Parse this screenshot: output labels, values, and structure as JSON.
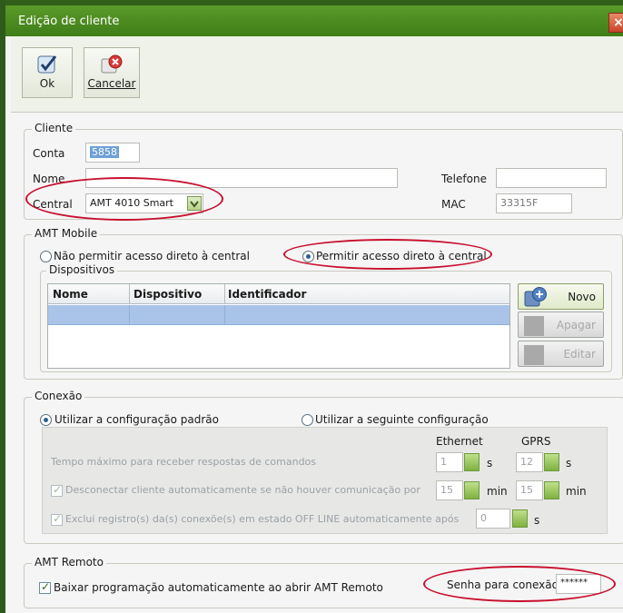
{
  "window": {
    "title": "Edição de cliente",
    "close": "×"
  },
  "toolbar": {
    "ok_label": "Ok",
    "cancel_label": "Cancelar"
  },
  "cliente": {
    "legend": "Cliente",
    "conta_label": "Conta",
    "conta_value": "5858",
    "nome_label": "Nome",
    "nome_value": "",
    "central_label": "Central",
    "central_value": "AMT 4010 Smart",
    "telefone_label": "Telefone",
    "telefone_value": "",
    "mac_label": "MAC",
    "mac_value": "33315F"
  },
  "amt_mobile": {
    "legend": "AMT Mobile",
    "option_no_access": "Não permitir acesso direto à central",
    "option_allow_access": "Permitir acesso direto à central",
    "dispositivos_legend": "Dispositivos",
    "columns": [
      "Nome",
      "Dispositivo",
      "Identificador"
    ],
    "buttons": {
      "novo": "Novo",
      "apagar": "Apagar",
      "editar": "Editar"
    }
  },
  "conexao": {
    "legend": "Conexão",
    "option_default": "Utilizar a configuração padrão",
    "option_custom": "Utilizar a seguinte configuração",
    "ethernet_label": "Ethernet",
    "gprs_label": "GPRS",
    "timeout_label": "Tempo máximo para receber respostas de comandos",
    "timeout_ethernet": "1",
    "timeout_gprs": "12",
    "unit_s": "s",
    "disconnect_label": "Desconectar cliente automaticamente se não houver comunicação por",
    "disconnect_ethernet": "15",
    "disconnect_gprs": "15",
    "unit_min": "min",
    "offline_label": "Exclui registro(s) da(s) conexõe(s) em estado OFF LINE automaticamente após",
    "offline_value": "0"
  },
  "amt_remoto": {
    "legend": "AMT Remoto",
    "auto_download_label": "Baixar programação automaticamente ao abrir AMT Remoto",
    "senha_label": "Senha para conexão",
    "senha_value": "******"
  },
  "colors": {
    "titlebar": "#4a8a22",
    "selection": "#a9c4e8",
    "annotation": "#c8102e"
  }
}
